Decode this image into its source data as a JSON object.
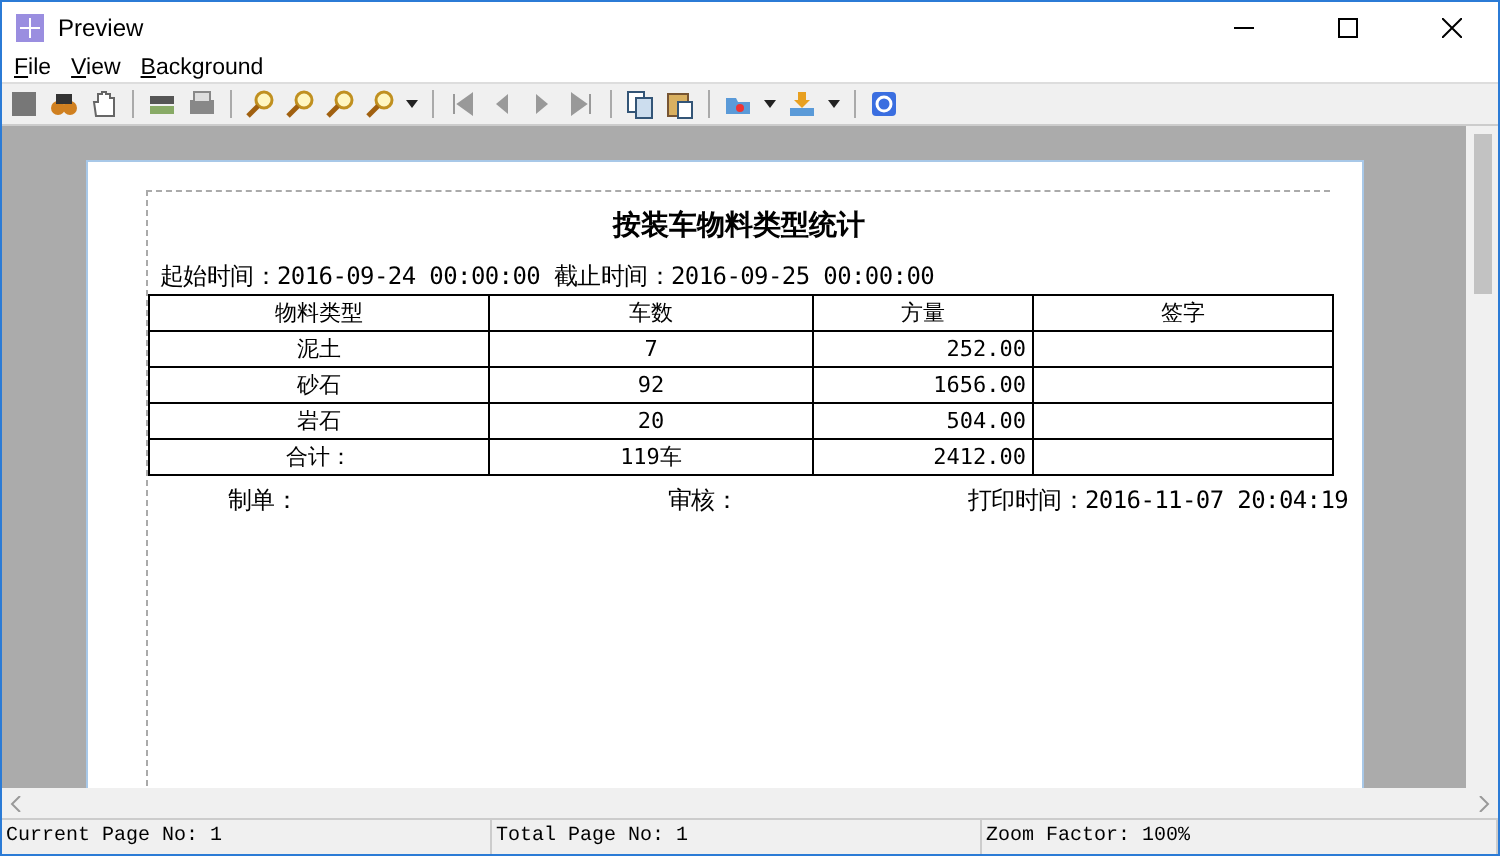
{
  "window": {
    "title": "Preview"
  },
  "menu": [
    {
      "label": "File"
    },
    {
      "label": "View"
    },
    {
      "label": "Background"
    }
  ],
  "report": {
    "title": "按装车物料类型统计",
    "range": "起始时间：2016-09-24 00:00:00 截止时间：2016-09-25 00:00:00",
    "columns": [
      "物料类型",
      "车数",
      "方量",
      "签字"
    ],
    "rows": [
      {
        "cells": [
          "泥土",
          "7",
          "252.00",
          null
        ]
      },
      {
        "cells": [
          "砂石",
          "92",
          "1656.00",
          null
        ]
      },
      {
        "cells": [
          "岩石",
          "20",
          "504.00",
          null
        ]
      },
      {
        "cells": [
          "合计：",
          "119车",
          "2412.00",
          null
        ]
      }
    ],
    "footer": [
      "制单：",
      "审核：",
      "打印时间：2016-11-07 20:04:19"
    ]
  },
  "status_bar": [
    "Current Page No: 1",
    "Total Page No: 1",
    "Zoom Factor: 100%"
  ]
}
